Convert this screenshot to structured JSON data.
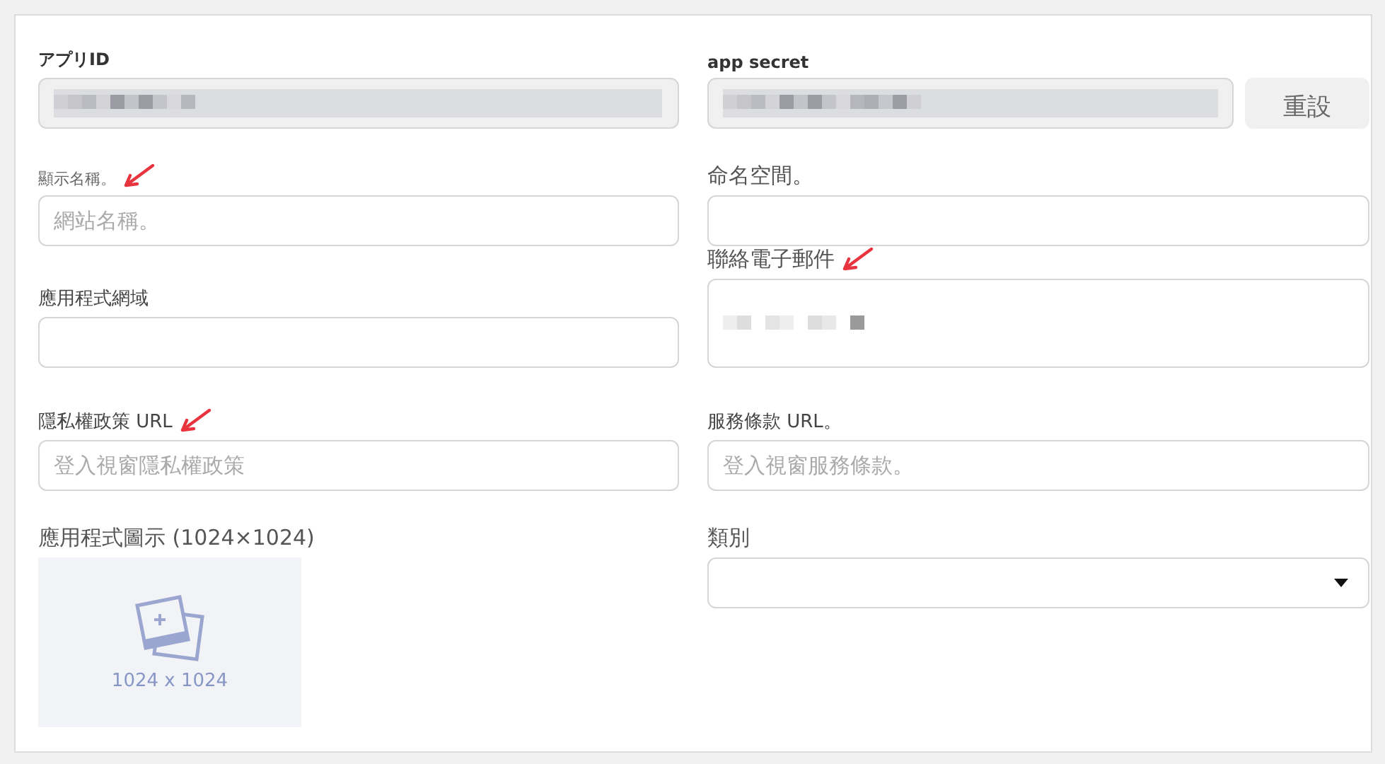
{
  "columns": [
    [
      {
        "label": "アプリID",
        "kind": "redacted"
      },
      {
        "label": "顯示名稱。",
        "kind": "text",
        "placeholder": "網站名稱。",
        "annotated": true
      },
      {
        "label": "應用程式網域",
        "kind": "text"
      },
      {
        "label": "隱私權政策 URL",
        "kind": "text",
        "placeholder": "登入視窗隱私權政策",
        "annotated": true
      },
      {
        "label": "應用程式圖示 (1024×1024)",
        "kind": "image",
        "caption": "1024 x 1024"
      }
    ],
    [
      {
        "label": "app secret",
        "kind": "redacted",
        "button": "重設"
      },
      {
        "label": "命名空間。",
        "kind": "text"
      },
      {
        "label": "聯絡電子郵件",
        "kind": "redacted_light",
        "annotated": true
      },
      {
        "label": "服務條款 URL。",
        "kind": "text",
        "placeholder": "登入視窗服務條款。"
      },
      {
        "label": "類別",
        "kind": "select"
      }
    ]
  ]
}
